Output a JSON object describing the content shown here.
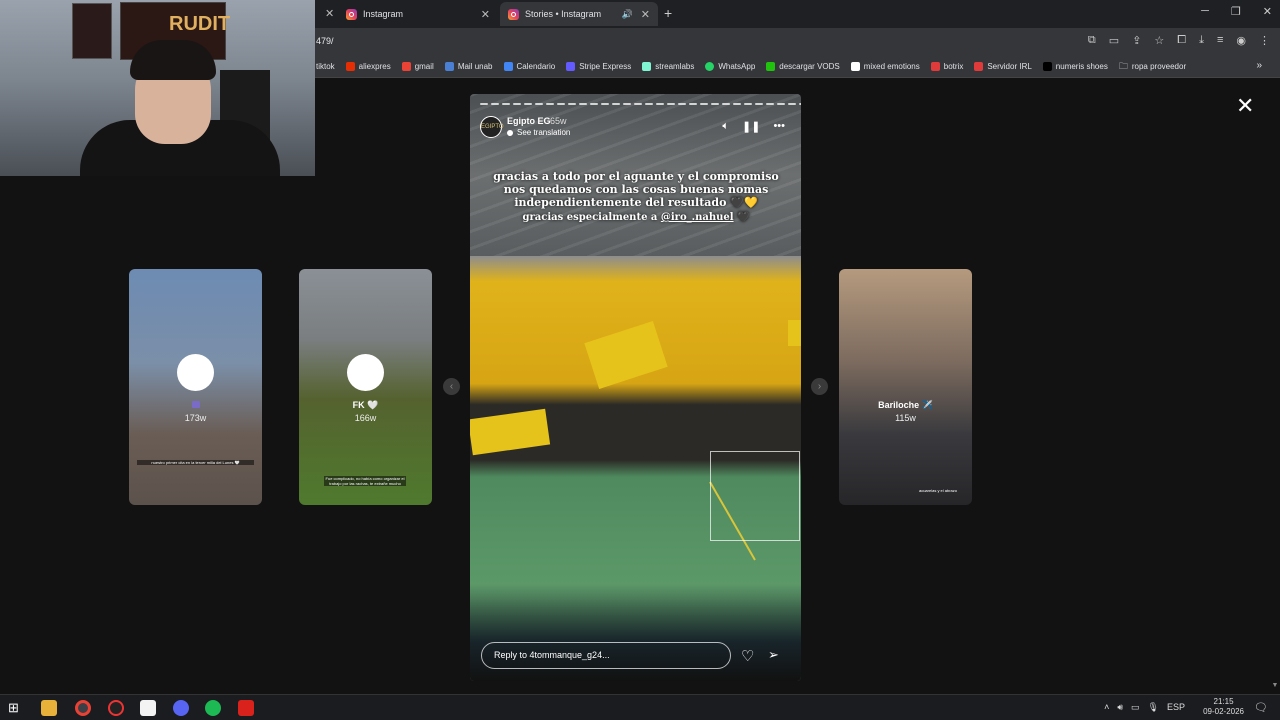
{
  "browser": {
    "tabs": [
      {
        "label": "Instagram",
        "active": false
      },
      {
        "label": "Stories • Instagram",
        "active": true
      }
    ],
    "url": "479/",
    "bookmarks": [
      {
        "label": "tiktok",
        "color": "#000000"
      },
      {
        "label": "aliexpres",
        "color": "#e62e04"
      },
      {
        "label": "gmail",
        "color": "#ea4335"
      },
      {
        "label": "Mail unab",
        "color": "#4a7fd4"
      },
      {
        "label": "Calendario",
        "color": "#4285f4"
      },
      {
        "label": "Stripe Express",
        "color": "#635bff"
      },
      {
        "label": "streamlabs",
        "color": "#80f5d2"
      },
      {
        "label": "WhatsApp",
        "color": "#25d366"
      },
      {
        "label": "descargar VODS",
        "color": "#20c20e"
      },
      {
        "label": "mixed emotions",
        "color": "#ffffff"
      },
      {
        "label": "botrix",
        "color": "#e03a3a"
      },
      {
        "label": "Servidor IRL",
        "color": "#e03a3a"
      },
      {
        "label": "numeris shoes",
        "color": "#222222"
      },
      {
        "label": "ropa proveedor",
        "color": "#aaaaaa"
      }
    ]
  },
  "webcam": {
    "poster_text": "RUDIT"
  },
  "stories": {
    "side": [
      {
        "name": "",
        "time": "173w",
        "caption": "nuestro primer cita en la tercer milla del Lunes 🤍"
      },
      {
        "name": "FK 🤍",
        "time": "166w",
        "caption": "Fue complicado, no había como organizar el trabajo por las rachas, te extrañe mucho"
      },
      {
        "name": "Bariloche ✈️",
        "time": "115w",
        "caption": "acuarelas y el abrazo"
      }
    ],
    "main": {
      "username": "Egipto EG",
      "time": "65w",
      "see_translation": "See translation",
      "avatar_text": "EGIPTO",
      "caption_line1": "gracias a todo por el aguante y el compromiso nos quedamos con las cosas buenas nomas independientemente del resultado 🖤💛",
      "caption_line2_prefix": "gracias especialmente a ",
      "caption_mention": "@iro_.nahuel",
      "caption_line2_suffix": " 🖤",
      "reply_placeholder": "Reply to 4tommanque_g24..."
    }
  },
  "taskbar": {
    "language": "ESP",
    "time": "21:15",
    "date": "09-02-2026"
  }
}
